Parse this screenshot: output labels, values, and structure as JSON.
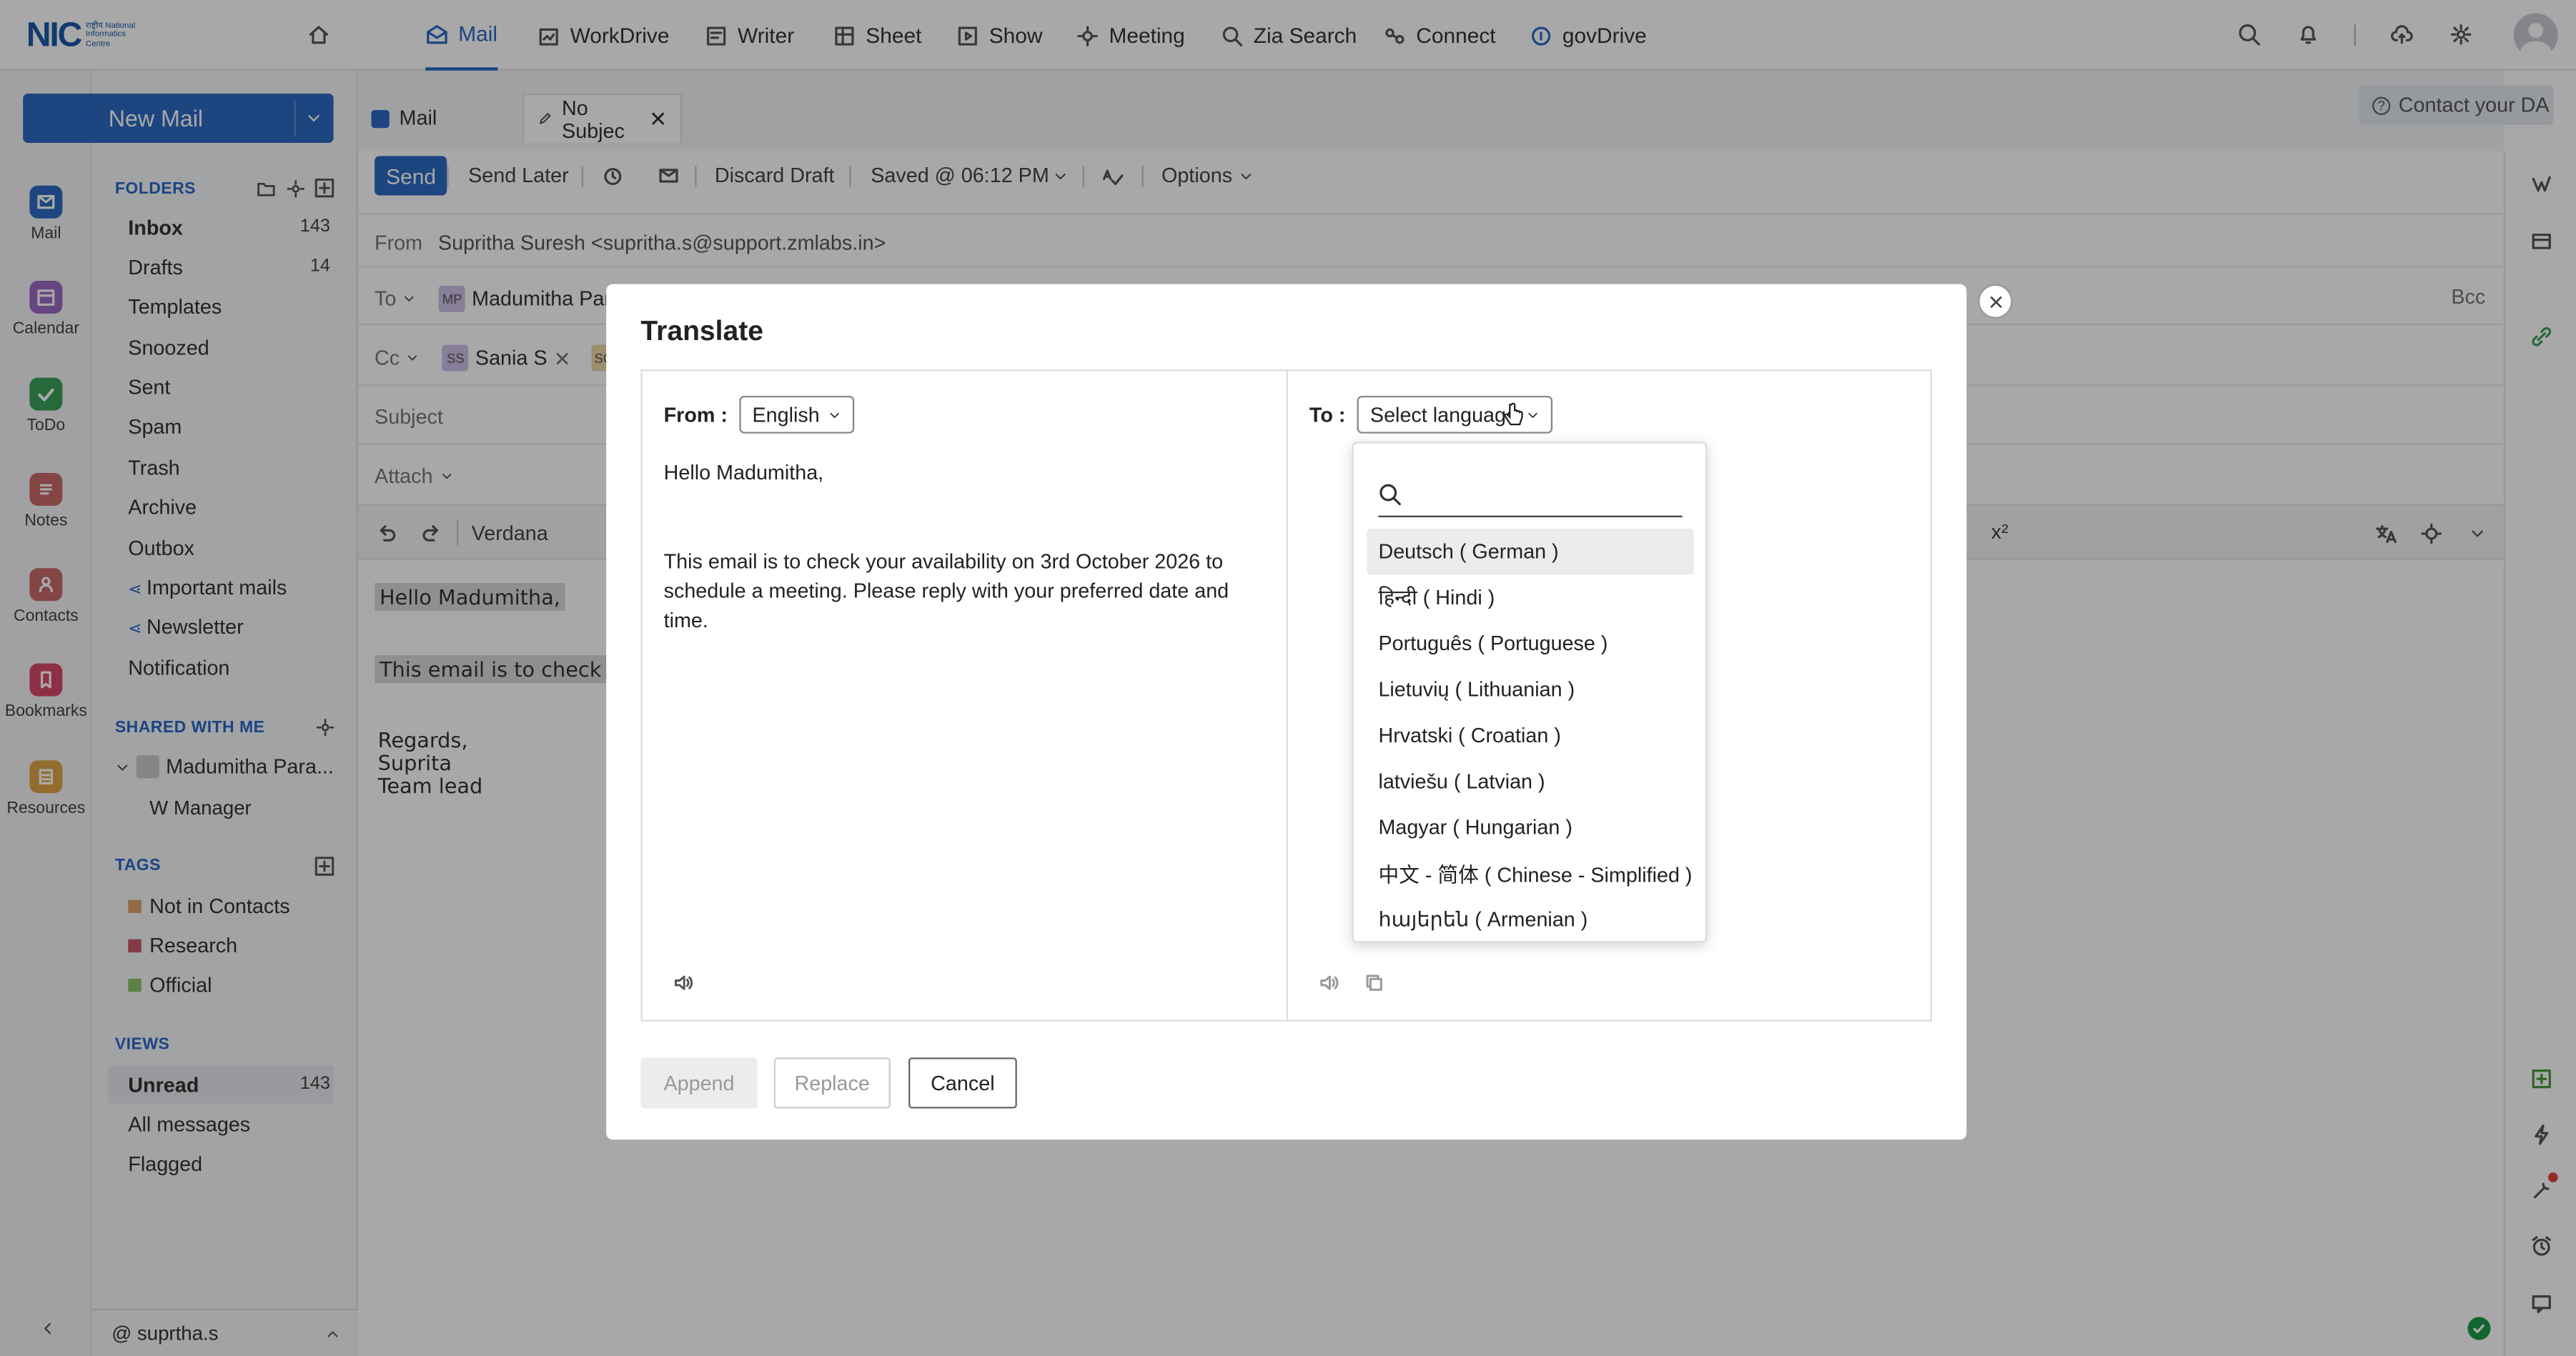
{
  "topbar": {
    "logo_text": "NIC",
    "logo_sub": "राष्ट्रीय National Informatics Centre",
    "apps": [
      "Mail",
      "WorkDrive",
      "Writer",
      "Sheet",
      "Show",
      "Meeting",
      "Zia Search",
      "Connect",
      "govDrive"
    ],
    "active_app": "Mail"
  },
  "rail": [
    "Mail",
    "Calendar",
    "ToDo",
    "Notes",
    "Contacts",
    "Bookmarks",
    "Resources"
  ],
  "folders": {
    "new_mail": "New Mail",
    "folders_head": "FOLDERS",
    "items": [
      {
        "label": "Inbox",
        "count": "143"
      },
      {
        "label": "Drafts",
        "count": "14"
      },
      {
        "label": "Templates",
        "count": ""
      },
      {
        "label": "Snoozed",
        "count": ""
      },
      {
        "label": "Sent",
        "count": ""
      },
      {
        "label": "Spam",
        "count": ""
      },
      {
        "label": "Trash",
        "count": ""
      },
      {
        "label": "Archive",
        "count": ""
      },
      {
        "label": "Outbox",
        "count": ""
      },
      {
        "label": "Important mails",
        "count": ""
      },
      {
        "label": "Newsletter",
        "count": ""
      },
      {
        "label": "Notification",
        "count": ""
      }
    ],
    "shared_head": "SHARED WITH ME",
    "shared_user": "Madumitha Para...",
    "shared_sub": "W Manager",
    "tags_head": "TAGS",
    "tags": [
      {
        "label": "Not in Contacts",
        "color": "#e0a46a"
      },
      {
        "label": "Research",
        "color": "#c85a6a"
      },
      {
        "label": "Official",
        "color": "#8fc26a"
      }
    ],
    "views_head": "VIEWS",
    "views": [
      {
        "label": "Unread",
        "count": "143"
      },
      {
        "label": "All messages",
        "count": ""
      },
      {
        "label": "Flagged",
        "count": ""
      }
    ],
    "user": "suprtha.s"
  },
  "compose": {
    "tab_mail": "Mail",
    "tab_draft": "No Subjec",
    "contact_da": "Contact your DA",
    "send": "Send",
    "send_later": "Send Later",
    "discard": "Discard Draft",
    "saved": "Saved @ 06:12 PM",
    "options": "Options",
    "from_label": "From",
    "from_value": "Supritha Suresh <supritha.s@support.zmlabs.in>",
    "to_label": "To",
    "to_chip_initials": "MP",
    "to_chip_name": "Madumitha Para",
    "cc_label": "Cc",
    "cc_chip_initials": "SS",
    "cc_chip_name": "Sania S",
    "cc_chip2_initials": "SG",
    "bcc": "Bcc",
    "subject_label": "Subject",
    "attach_label": "Attach",
    "font": "Verdana",
    "superscript": "x²",
    "body_greeting": "Hello Madumitha,",
    "body_line": "This email is to check yo",
    "body_regards": "Regards,",
    "body_name": "Suprita",
    "body_title": "Team lead"
  },
  "translate": {
    "title": "Translate",
    "from_label": "From :",
    "from_lang": "English",
    "to_label": "To :",
    "to_placeholder": "Select language",
    "source_greeting": "Hello Madumitha,",
    "source_body": "This email is to check your availability on 3rd October 2026 to schedule a meeting. Please reply with your preferred date and time.",
    "append": "Append",
    "replace": "Replace",
    "cancel": "Cancel",
    "search_placeholder": "",
    "languages": [
      "Deutsch ( German )",
      "हिन्दी ( Hindi )",
      "Português ( Portuguese )",
      "Lietuvių ( Lithuanian )",
      "Hrvatski ( Croatian )",
      "latviešu ( Latvian )",
      "Magyar ( Hungarian )",
      "中文 - 简体 ( Chinese - Simplified )",
      "հայերեն ( Armenian )"
    ]
  }
}
